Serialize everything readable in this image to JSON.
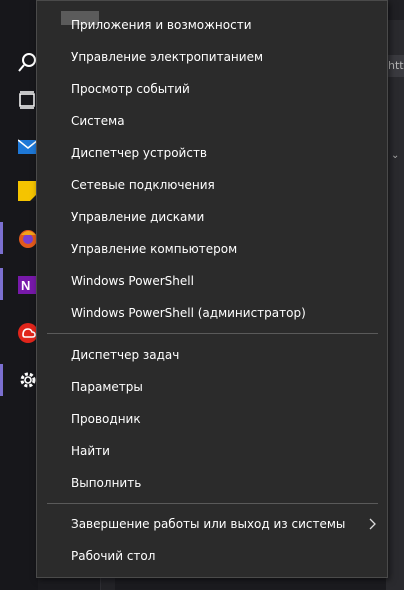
{
  "menu": {
    "items": [
      {
        "label": "Приложения и возможности"
      },
      {
        "label": "Управление электропитанием"
      },
      {
        "label": "Просмотр событий"
      },
      {
        "label": "Система"
      },
      {
        "label": "Диспетчер устройств"
      },
      {
        "label": "Сетевые подключения"
      },
      {
        "label": "Управление дисками"
      },
      {
        "label": "Управление компьютером"
      },
      {
        "label": "Windows PowerShell"
      },
      {
        "label": "Windows PowerShell (администратор)"
      },
      {
        "label": "Диспетчер задач"
      },
      {
        "label": "Параметры"
      },
      {
        "label": "Проводник"
      },
      {
        "label": "Найти"
      },
      {
        "label": "Выполнить"
      },
      {
        "label": "Завершение работы или выход из системы"
      },
      {
        "label": "Рабочий стол"
      }
    ]
  },
  "taskbar": {
    "icons": [
      "search-icon",
      "task-view-icon",
      "mail-icon",
      "sticky-notes-icon",
      "firefox-icon",
      "onenote-icon",
      "creative-cloud-icon",
      "settings-gear-icon"
    ]
  },
  "background": {
    "url_fragment": "http"
  },
  "colors": {
    "menu_bg": "#2b2b2b",
    "menu_text": "#ffffff",
    "separator": "#5a5a5a",
    "accent": "#7b6fd0"
  }
}
